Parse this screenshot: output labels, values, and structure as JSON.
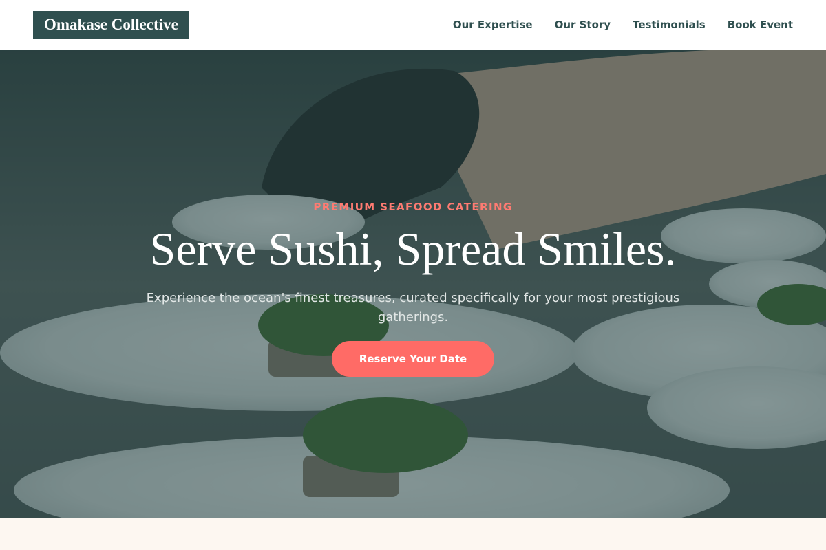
{
  "brand": {
    "name": "Omakase Collective"
  },
  "nav": {
    "items": [
      {
        "label": "Our Expertise"
      },
      {
        "label": "Our Story"
      },
      {
        "label": "Testimonials"
      },
      {
        "label": "Book Event"
      }
    ]
  },
  "hero": {
    "eyebrow": "PREMIUM SEAFOOD CATERING",
    "title": "Serve Sushi, Spread Smiles.",
    "subtitle": "Experience the ocean's finest treasures, curated specifically for your most prestigious gatherings.",
    "cta_label": "Reserve Your Date",
    "image_subject": "chef-plating-sushi-dishes"
  },
  "colors": {
    "brand_dark": "#2f4f4f",
    "accent_coral": "#ff6b66",
    "eyebrow_coral": "#ff7b72",
    "page_cream": "#fdf7f1"
  }
}
